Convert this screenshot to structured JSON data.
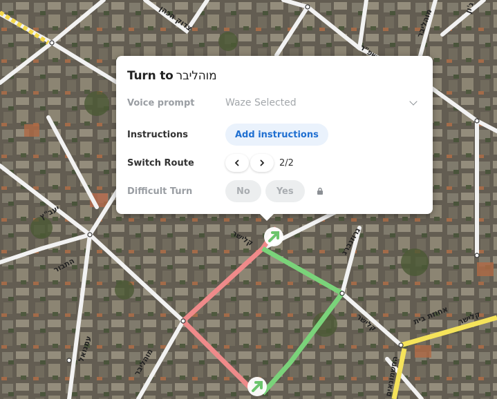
{
  "popup": {
    "title_prefix": "Turn to",
    "title_street": "מוהליבר",
    "voice_prompt": {
      "label": "Voice prompt",
      "value": "Waze Selected"
    },
    "instructions": {
      "label": "Instructions",
      "button": "Add instructions"
    },
    "switch_route": {
      "label": "Switch Route",
      "counter": "2/2"
    },
    "difficult_turn": {
      "label": "Difficult Turn",
      "no": "No",
      "yes": "Yes"
    }
  },
  "map": {
    "street_labels": [
      "צדוק הכהן",
      "מוהליבר",
      "שפ\"ר",
      "גרוזנברג",
      "קלישר",
      "יעב\"ץ",
      "התבור",
      "עמנואל",
      "מוהליבר",
      "קלישר",
      "גרוזנברג",
      "אחוזת בית",
      "קלישר",
      "החשמונאים",
      "ג'ון"
    ],
    "route_colors": {
      "route_a": "#ef8a8a",
      "route_b": "#7ad37a",
      "arrow": "#6cc46c"
    }
  }
}
